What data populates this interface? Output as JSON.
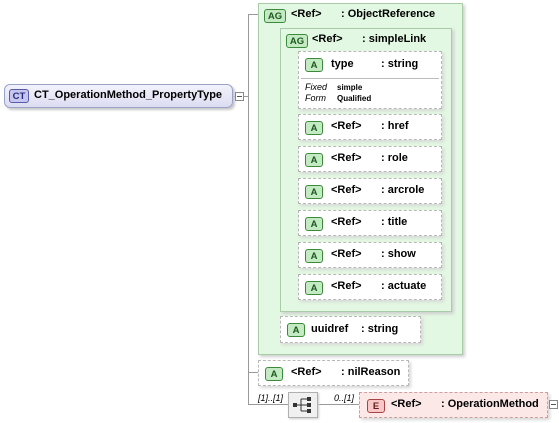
{
  "complex_type": {
    "badge": "CT",
    "name": "CT_OperationMethod_PropertyType"
  },
  "object_reference": {
    "badge": "AG",
    "ref": "<Ref>",
    "type": ": ObjectReference"
  },
  "simple_link": {
    "badge": "AG",
    "ref": "<Ref>",
    "type": ": simpleLink"
  },
  "type_attr": {
    "badge": "A",
    "name": "type",
    "type": ": string",
    "fixed_label": "Fixed",
    "fixed_value": "simple",
    "form_label": "Form",
    "form_value": "Qualified"
  },
  "link_attrs": [
    {
      "badge": "A",
      "ref": "<Ref>",
      "name": ": href"
    },
    {
      "badge": "A",
      "ref": "<Ref>",
      "name": ": role"
    },
    {
      "badge": "A",
      "ref": "<Ref>",
      "name": ": arcrole"
    },
    {
      "badge": "A",
      "ref": "<Ref>",
      "name": ": title"
    },
    {
      "badge": "A",
      "ref": "<Ref>",
      "name": ": show"
    },
    {
      "badge": "A",
      "ref": "<Ref>",
      "name": ": actuate"
    }
  ],
  "uuidref": {
    "badge": "A",
    "name": "uuidref",
    "type": ": string"
  },
  "nil_reason": {
    "badge": "A",
    "ref": "<Ref>",
    "name": ": nilReason"
  },
  "sequence": {
    "occurs": "[1]..[1]"
  },
  "operation_method": {
    "badge": "E",
    "ref": "<Ref>",
    "name": ": OperationMethod",
    "occurs": "0..[1]"
  }
}
